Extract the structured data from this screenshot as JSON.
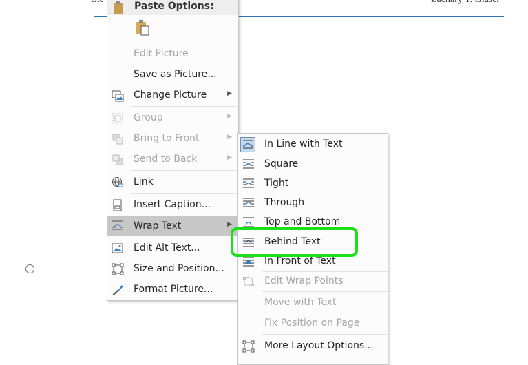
{
  "document": {
    "header_left": "Ste",
    "header_right": "Zachary T. Glaser"
  },
  "context_menu": {
    "paste_options_label": "Paste Options:",
    "items": [
      {
        "label": "Edit Picture",
        "disabled": true,
        "icon": "none"
      },
      {
        "label": "Save as Picture...",
        "disabled": false,
        "icon": "none"
      },
      {
        "label": "Change Picture",
        "disabled": false,
        "icon": "change-picture-icon",
        "submenu": true
      },
      {
        "label": "Group",
        "disabled": true,
        "icon": "group-icon",
        "submenu": true
      },
      {
        "label": "Bring to Front",
        "disabled": true,
        "icon": "bring-to-front-icon",
        "submenu": true
      },
      {
        "label": "Send to Back",
        "disabled": true,
        "icon": "send-to-back-icon",
        "submenu": true
      },
      {
        "label": "Link",
        "disabled": false,
        "icon": "link-icon"
      },
      {
        "label": "Insert Caption...",
        "disabled": false,
        "icon": "insert-caption-icon"
      },
      {
        "label": "Wrap Text",
        "disabled": false,
        "icon": "wrap-text-icon",
        "submenu": true,
        "highlighted": true
      },
      {
        "label": "Edit Alt Text...",
        "disabled": false,
        "icon": "alt-text-icon"
      },
      {
        "label": "Size and Position...",
        "disabled": false,
        "icon": "size-position-icon"
      },
      {
        "label": "Format Picture...",
        "disabled": false,
        "icon": "format-picture-icon"
      }
    ]
  },
  "wrap_submenu": {
    "items": [
      {
        "label": "In Line with Text",
        "disabled": false,
        "selected": true
      },
      {
        "label": "Square",
        "disabled": false
      },
      {
        "label": "Tight",
        "disabled": false
      },
      {
        "label": "Through",
        "disabled": false
      },
      {
        "label": "Top and Bottom",
        "disabled": false
      },
      {
        "label": "Behind Text",
        "disabled": false,
        "annotated": true
      },
      {
        "label": "In Front of Text",
        "disabled": false
      },
      {
        "label": "Edit Wrap Points",
        "disabled": true
      },
      {
        "label": "Move with Text",
        "disabled": true
      },
      {
        "label": "Fix Position on Page",
        "disabled": true
      },
      {
        "label": "More Layout Options...",
        "disabled": false
      }
    ]
  },
  "colors": {
    "highlight": "#c7c7c7",
    "annotation": "#1be01b",
    "doc_rule": "#2e75b6"
  }
}
